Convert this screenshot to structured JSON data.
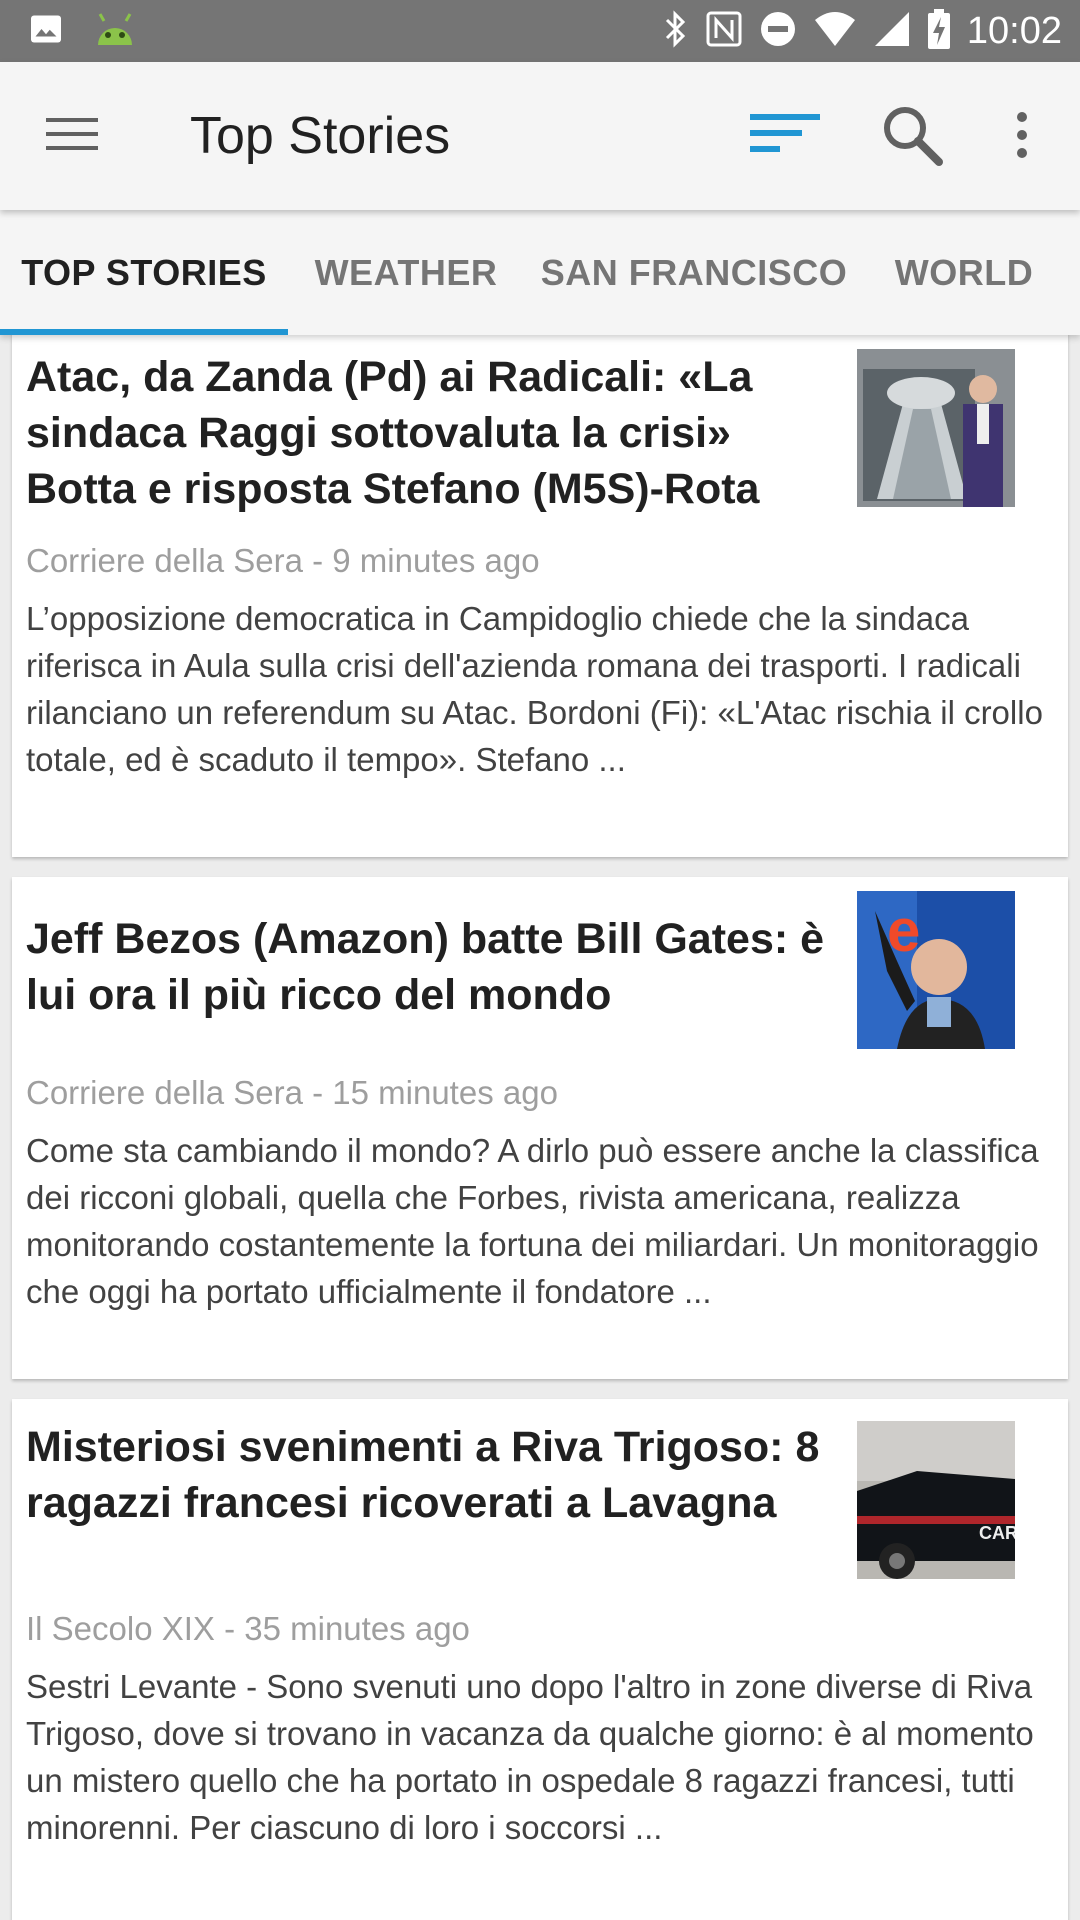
{
  "status_bar": {
    "time": "10:02",
    "left_icons": [
      "image-icon",
      "android-icon"
    ],
    "right_icons": [
      "bluetooth-icon",
      "nfc-icon",
      "do-not-disturb-icon",
      "wifi-icon",
      "cell-signal-icon",
      "battery-charging-icon"
    ]
  },
  "app_bar": {
    "title": "Top Stories",
    "icons": [
      "menu-icon",
      "sort-icon",
      "search-icon",
      "more-vert-icon"
    ]
  },
  "colors": {
    "accent": "#2196d3",
    "status_bar": "#757575",
    "app_bar": "#f5f5f5",
    "background": "#ececec"
  },
  "tabs": [
    {
      "label": "TOP STORIES",
      "active": true
    },
    {
      "label": "WEATHER",
      "active": false
    },
    {
      "label": "SAN FRANCISCO",
      "active": false
    },
    {
      "label": "WORLD",
      "active": false
    }
  ],
  "articles": [
    {
      "title": "Atac, da Zanda (Pd) ai Radicali: «La sindaca Raggi sottovaluta la crisi» Botta e risposta Stefano (M5S)-Rota",
      "meta": "Corriere della Sera - 9 minutes ago",
      "snippet": "L’opposizione democratica in Campidoglio chiede che la sindaca riferisca in Aula sulla crisi dell'azienda romana dei trasporti. I radicali rilanciano un referendum su Atac. Bordoni (Fi): «L'Atac rischia il crollo totale, ed è scaduto il tempo». Stefano ...",
      "thumbnail": "subway-tunnel-photo"
    },
    {
      "title": "Jeff Bezos (Amazon) batte Bill Gates: è lui ora il più ricco del mondo",
      "meta": "Corriere della Sera - 15 minutes ago",
      "snippet": "Come sta cambiando il mondo? A dirlo può essere anche la classifica dei ricconi globali, quella che Forbes, rivista americana, realizza monitorando costantemente la fortuna dei miliardari. Un monitoraggio che oggi ha portato ufficialmente il fondatore ...",
      "thumbnail": "person-photo"
    },
    {
      "title": "Misteriosi svenimenti a Riva Trigoso: 8 ragazzi francesi ricoverati a Lavagna",
      "meta": "Il Secolo XIX - 35 minutes ago",
      "snippet": "Sestri Levante - Sono svenuti uno dopo l'altro in zone diverse di Riva Trigoso, dove si trovano in vacanza da qualche giorno: è al momento un mistero quello che ha portato in ospedale 8 ragazzi francesi, tutti minorenni. Per ciascuno di loro i soccorsi ...",
      "thumbnail": "police-car-photo",
      "thumbnail_text": "CAR"
    }
  ]
}
